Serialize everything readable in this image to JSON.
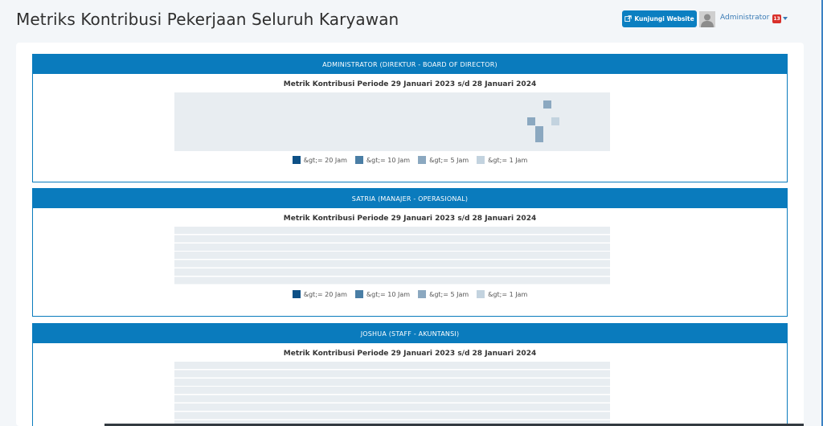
{
  "header": {
    "title": "Metriks Kontribusi Pekerjaan Seluruh Karyawan",
    "visit_button_label": "Kunjungi Website",
    "user_name": "Administrator",
    "notification_count": "13"
  },
  "colors": {
    "primary": "#0a7bbd",
    "level_20": "#0d5086",
    "level_10": "#4a7ea5",
    "level_5": "#8ba8c0",
    "level_1": "#c3d3df",
    "empty_cell": "#e8edf1"
  },
  "legend": [
    "&gt;= 20 Jam",
    "&gt;= 10 Jam",
    "&gt;= 5 Jam",
    "&gt;= 1 Jam"
  ],
  "panels": [
    {
      "header": "ADMINISTRATOR (DIREKTUR - BOARD OF DIRECTOR)",
      "metric_title": "Metrik Kontribusi Periode 29 Januari 2023 s/d 28 Januari 2024",
      "cells": [
        {
          "level": 5,
          "week": 45,
          "day": 1
        },
        {
          "level": 5,
          "week": 43,
          "day": 3
        },
        {
          "level": 5,
          "week": 44,
          "day": 4
        },
        {
          "level": 5,
          "week": 44,
          "day": 5
        },
        {
          "level": 1,
          "week": 46,
          "day": 3
        }
      ]
    },
    {
      "header": "SATRIA (MANAJER - OPERASIONAL)",
      "metric_title": "Metrik Kontribusi Periode 29 Januari 2023 s/d 28 Januari 2024",
      "cells": []
    },
    {
      "header": "JOSHUA (STAFF - AKUNTANSI)",
      "metric_title": "Metrik Kontribusi Periode 29 Januari 2023 s/d 28 Januari 2024",
      "cells": []
    }
  ]
}
